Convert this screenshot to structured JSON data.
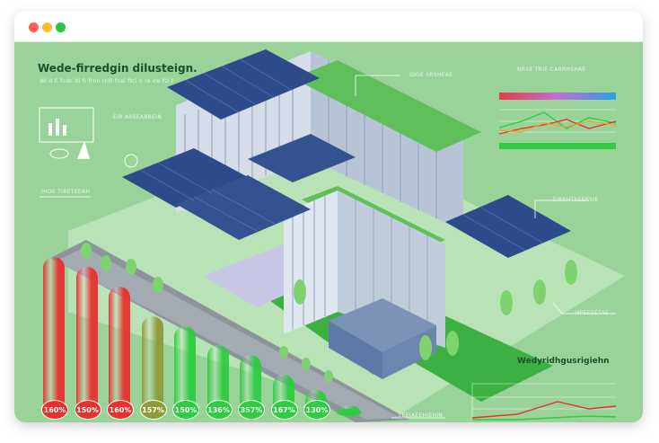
{
  "colors": {
    "background": "#9ad39a",
    "red": "#e8312f",
    "green": "#2ecc40",
    "olive": "#8f9a3a",
    "title_text": "#1f4f2a"
  },
  "window": {
    "controls": [
      {
        "name": "close",
        "color": "#ff5f56"
      },
      {
        "name": "minimize",
        "color": "#ffbd2e"
      },
      {
        "name": "maximize",
        "color": "#27c93f"
      }
    ]
  },
  "header": {
    "title": "Wede-firredgin dilusteign.",
    "subtitle": "Wi d fi fcdc iti fi frnn rrifi fnsi ftci n re ire fsi fwnt fh rri fv di n ic ticf"
  },
  "labels": {
    "icon_panel": "EIR ARSEARBEIN",
    "left_mid": "IHOE TIRETEEAH",
    "building_top": "IDGE IIRSHEAE",
    "right_top_title": "NRSE TRIE CARRHSHAE",
    "right_mid": "EIRSHTSEERSIE",
    "right_lower": "HPEESETAE",
    "bottom_right_title": "Wedyridhgusrigiehn",
    "bottom_center": "LEEIAEEHIEHIN"
  },
  "bars": [
    {
      "label": "160%",
      "value": 160,
      "color": "#e8312f"
    },
    {
      "label": "150%",
      "value": 150,
      "color": "#e8312f"
    },
    {
      "label": "160%",
      "value": 130,
      "color": "#e8312f"
    },
    {
      "label": "157%",
      "value": 100,
      "color": "#8f9a3a"
    },
    {
      "label": "150%",
      "value": 90,
      "color": "#2ecc40"
    },
    {
      "label": "136%",
      "value": 70,
      "color": "#2ecc40"
    },
    {
      "label": "357%",
      "value": 60,
      "color": "#2ecc40"
    },
    {
      "label": "167%",
      "value": 40,
      "color": "#2ecc40"
    },
    {
      "label": "130%",
      "value": 25,
      "color": "#2ecc40"
    },
    {
      "label": "",
      "value": 8,
      "color": "#2ecc40"
    }
  ]
}
